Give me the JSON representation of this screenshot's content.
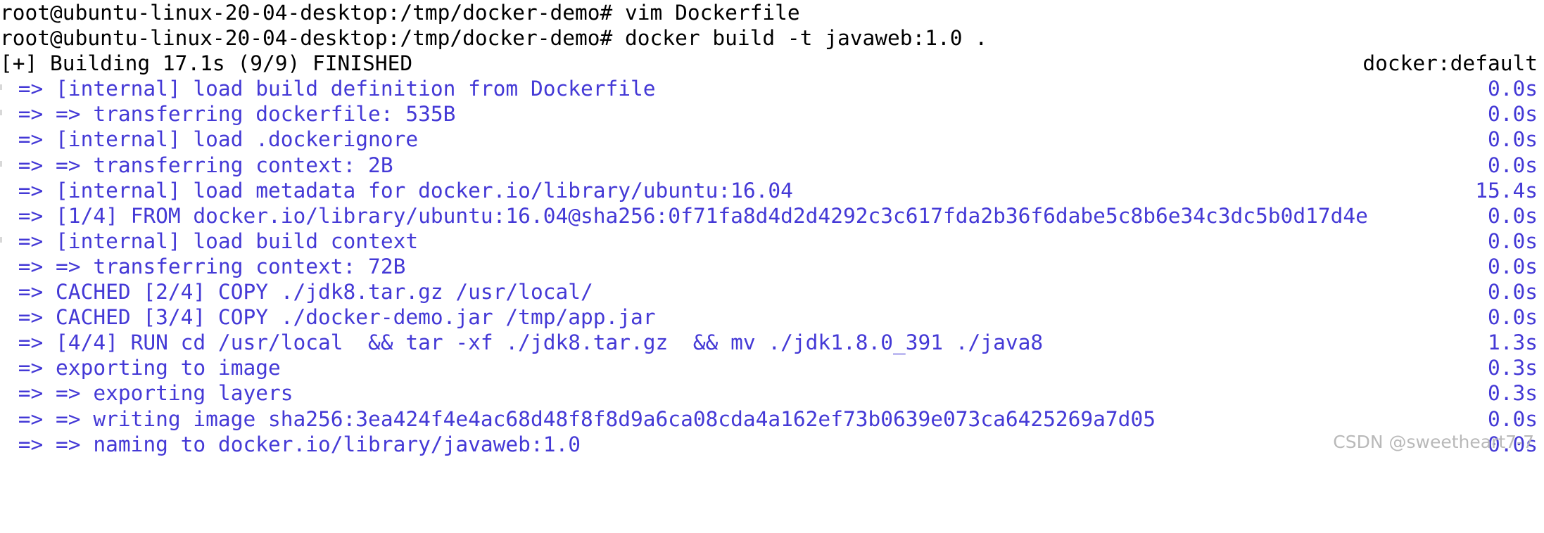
{
  "terminal": {
    "theme": {
      "background": "#ffffff",
      "prompt_color": "#000000",
      "step_color": "#4439d6",
      "watermark_color": "#b9b9b9"
    },
    "prompt_lines": [
      {
        "text": "root@ubuntu-linux-20-04-desktop:/tmp/docker-demo# vim Dockerfile"
      },
      {
        "text": "root@ubuntu-linux-20-04-desktop:/tmp/docker-demo# docker build -t javaweb:1.0 ."
      }
    ],
    "build_header": {
      "text": "[+] Building 17.1s (9/9) FINISHED",
      "right": "docker:default"
    },
    "steps": [
      {
        "text": " => [internal] load build definition from Dockerfile",
        "duration": "0.0s"
      },
      {
        "text": " => => transferring dockerfile: 535B",
        "duration": "0.0s"
      },
      {
        "text": " => [internal] load .dockerignore",
        "duration": "0.0s"
      },
      {
        "text": " => => transferring context: 2B",
        "duration": "0.0s"
      },
      {
        "text": " => [internal] load metadata for docker.io/library/ubuntu:16.04",
        "duration": "15.4s"
      },
      {
        "text": " => [1/4] FROM docker.io/library/ubuntu:16.04@sha256:0f71fa8d4d2d4292c3c617fda2b36f6dabe5c8b6e34c3dc5b0d17d4e",
        "duration": "0.0s"
      },
      {
        "text": " => [internal] load build context",
        "duration": "0.0s"
      },
      {
        "text": " => => transferring context: 72B",
        "duration": "0.0s"
      },
      {
        "text": " => CACHED [2/4] COPY ./jdk8.tar.gz /usr/local/",
        "duration": "0.0s"
      },
      {
        "text": " => CACHED [3/4] COPY ./docker-demo.jar /tmp/app.jar",
        "duration": "0.0s"
      },
      {
        "text": " => [4/4] RUN cd /usr/local  && tar -xf ./jdk8.tar.gz  && mv ./jdk1.8.0_391 ./java8",
        "duration": "1.3s"
      },
      {
        "text": " => exporting to image",
        "duration": "0.3s"
      },
      {
        "text": " => => exporting layers",
        "duration": "0.3s"
      },
      {
        "text": " => => writing image sha256:3ea424f4e4ac68d48f8f8d9a6ca08cda4a162ef73b0639e073ca6425269a7d05",
        "duration": "0.0s"
      },
      {
        "text": " => => naming to docker.io/library/javaweb:1.0",
        "duration": "0.0s"
      }
    ],
    "watermark": "CSDN @sweetheart7-7"
  }
}
